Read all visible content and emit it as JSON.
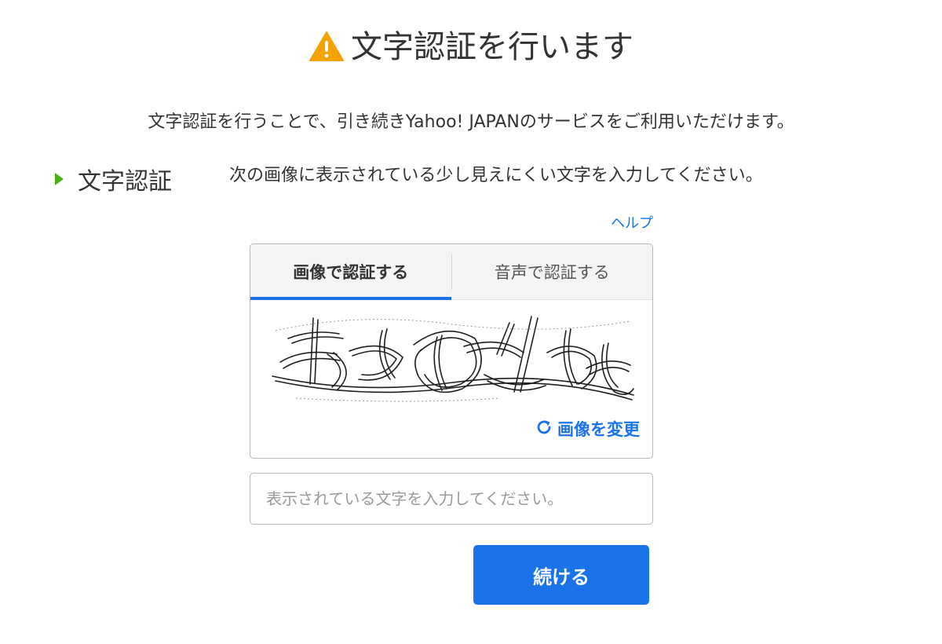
{
  "header": {
    "title": "文字認証を行います",
    "icon": "warning-icon",
    "icon_color": "#f5a300"
  },
  "description": "文字認証を行うことで、引き続きYahoo! JAPANのサービスをご利用いただけます。",
  "section": {
    "label": "文字認証",
    "marker_color": "#4caf1a",
    "instruction": "次の画像に表示されている少し見えにくい文字を入力してください。"
  },
  "help": {
    "label": "ヘルプ"
  },
  "captcha": {
    "tabs": [
      {
        "label": "画像で認証する",
        "active": true
      },
      {
        "label": "音声で認証する",
        "active": false
      }
    ],
    "refresh_label": "画像を変更",
    "refresh_icon": "refresh-icon"
  },
  "answer": {
    "value": "",
    "placeholder": "表示されている文字を入力してください。"
  },
  "submit": {
    "label": "続ける"
  },
  "colors": {
    "accent": "#1a73e8",
    "text": "#333333",
    "border": "#b9b9b9"
  }
}
